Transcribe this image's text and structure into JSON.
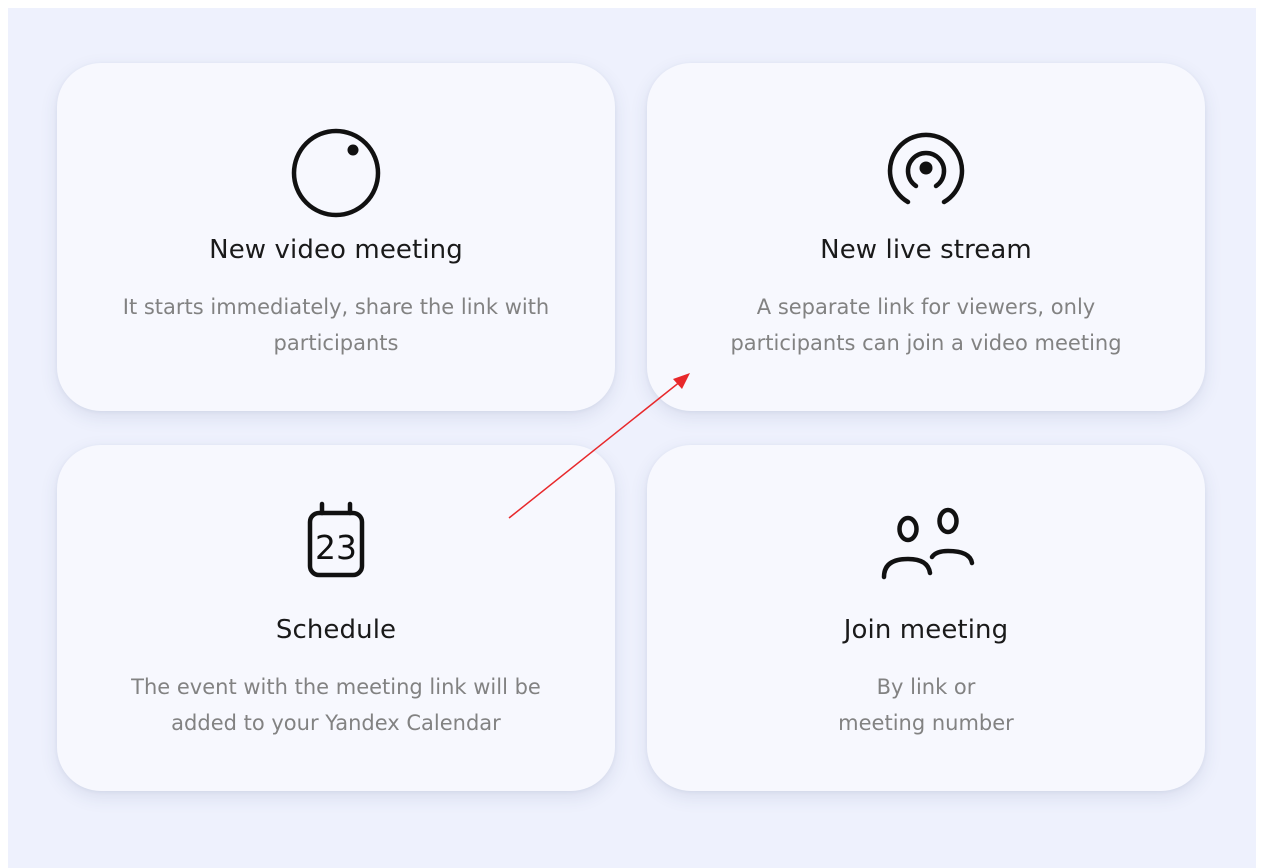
{
  "cards": [
    {
      "title": "New video meeting",
      "desc_lines": [
        "It starts immediately, share the link with",
        "participants"
      ],
      "icon": "video-camera-icon"
    },
    {
      "title": "New live stream",
      "desc_lines": [
        "A separate link for viewers, only",
        "participants can join a video meeting"
      ],
      "icon": "broadcast-icon"
    },
    {
      "title": "Schedule",
      "desc_lines": [
        "The event with the meeting link will be",
        "added to your Yandex Calendar"
      ],
      "icon": "calendar-icon",
      "icon_text": "23"
    },
    {
      "title": "Join meeting",
      "desc_lines": [
        "By link or",
        "meeting number"
      ],
      "icon": "participants-icon"
    }
  ],
  "colors": {
    "panel_background": "#eef1fd",
    "card_background": "#f7f8fe",
    "title_text": "#1a1a1a",
    "description_text": "#828282",
    "annotation_arrow": "#e8282b"
  }
}
